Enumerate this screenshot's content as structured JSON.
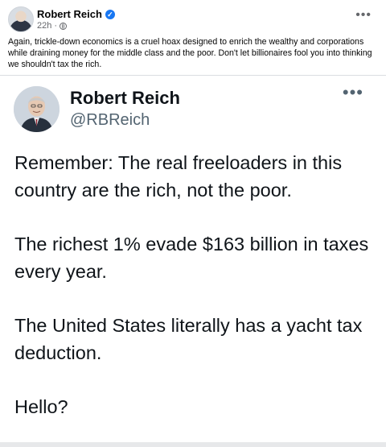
{
  "post": {
    "author": "Robert Reich",
    "verified_icon": "verified-badge-icon",
    "time": "22h",
    "separator": "·",
    "audience_icon": "globe-icon",
    "more_label": "•••",
    "caption": "Again, trickle-down economics is a cruel hoax designed to enrich the wealthy and corporations while draining money for the middle class and the poor. Don't let billionaires fool you into thinking we shouldn't tax the rich."
  },
  "tweet": {
    "name": "Robert Reich",
    "handle": "@RBReich",
    "more_label": "•••",
    "paragraphs": [
      "Remember: The real freeloaders in this country are the rich, not the poor.",
      "The richest 1% evade $163 billion in taxes every year.",
      "The United States literally has a yacht tax deduction.",
      "Hello?"
    ]
  },
  "colors": {
    "verified_blue": "#1877f2",
    "secondary_text": "#65676b",
    "tweet_handle": "#536471"
  }
}
